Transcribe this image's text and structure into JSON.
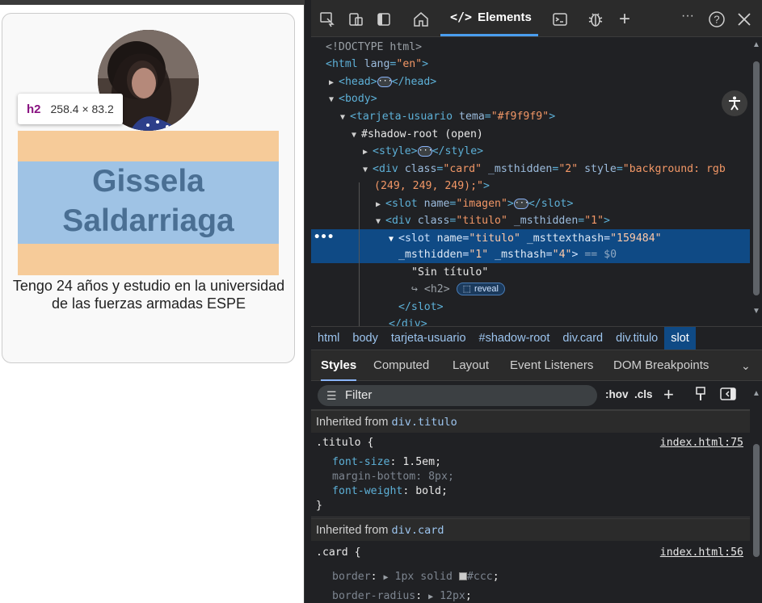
{
  "page": {
    "card": {
      "title": "Gissela Saldarriaga",
      "description": "Tengo 24 años y estudio en la universidad de las fuerzas armadas ESPE",
      "background": "#f9f9f9"
    },
    "tooltip": {
      "tag": "h2",
      "dimensions": "258.4 × 83.2"
    }
  },
  "devtools": {
    "toolbar": {
      "active_tab": "Elements",
      "icons": [
        "inspect-icon",
        "device-emulation-icon",
        "dock-side-icon",
        "welcome-home-icon",
        "elements-icon",
        "console-icon",
        "sources-bug-icon",
        "add-tab-icon",
        "more-options-icon",
        "help-icon",
        "close-icon"
      ]
    },
    "dom": {
      "doctype": "<!DOCTYPE html>",
      "html_open": "<html",
      "html_attr": "lang",
      "html_val": "\"en\"",
      "head": "<head>",
      "head_close": "</head>",
      "body": "<body>",
      "custom_el": "<tarjeta-usuario",
      "custom_attr": "tema",
      "custom_val": "\"#f9f9f9\"",
      "shadow_root": "#shadow-root (open)",
      "style_open": "<style>",
      "style_close": "</style>",
      "div_card_open": "<div",
      "div_card_attr1": "class",
      "div_card_val1": "\"card\"",
      "div_card_attr2": "_msthidden",
      "div_card_val2": "\"2\"",
      "div_card_attr3": "style",
      "div_card_val3a": "\"background: rgb",
      "div_card_val3b": "(249, 249, 249);\"",
      "slot_img_open": "<slot",
      "slot_img_attr": "name",
      "slot_img_val": "\"imagen\"",
      "slot_close": "</slot>",
      "div_titulo_open": "<div",
      "div_titulo_attr1": "class",
      "div_titulo_val1": "\"titulo\"",
      "div_titulo_attr2": "_msthidden",
      "div_titulo_val2": "\"1\"",
      "sel_slot_open": "<slot",
      "sel_attr1": "name",
      "sel_val1": "\"titulo\"",
      "sel_attr2": "_msttexthash",
      "sel_val2": "\"159484\"",
      "sel_attr3": "_msthidden",
      "sel_val3": "\"1\"",
      "sel_attr4": "_msthash",
      "sel_val4": "\"4\"",
      "sel_suffix": "== $0",
      "text_node": "\"Sin título\"",
      "h2_ref": "<h2>",
      "reveal": "reveal",
      "slot_end": "</slot>",
      "div_end": "</div>"
    },
    "breadcrumb": [
      "html",
      "body",
      "tarjeta-usuario",
      "#shadow-root",
      "div.card",
      "div.titulo",
      "slot"
    ],
    "styles_tabs": [
      "Styles",
      "Computed",
      "Layout",
      "Event Listeners",
      "DOM Breakpoints"
    ],
    "filter": {
      "placeholder": "Filter",
      "hov": ":hov",
      "cls": ".cls"
    },
    "rules": {
      "inherited_1_label": "Inherited from",
      "inherited_1_selector": "div.titulo",
      "rule_1_selector": ".titulo {",
      "rule_1_source": "index.html:75",
      "rule_1_props": [
        {
          "name": "font-size",
          "value": "1.5em"
        },
        {
          "name": "margin-bottom",
          "value": "8px"
        },
        {
          "name": "font-weight",
          "value": "bold"
        }
      ],
      "rule_1_close": "}",
      "inherited_2_label": "Inherited from",
      "inherited_2_selector": "div.card",
      "rule_2_selector": ".card {",
      "rule_2_source": "index.html:56",
      "rule_2_props": [
        {
          "name": "border",
          "value": "1px solid",
          "color": "#ccc"
        },
        {
          "name": "border-radius",
          "value": "12px"
        }
      ]
    },
    "colors": {
      "accent": "#4a9eef",
      "selection": "#0f4a85",
      "panel_bg": "#202124"
    }
  }
}
